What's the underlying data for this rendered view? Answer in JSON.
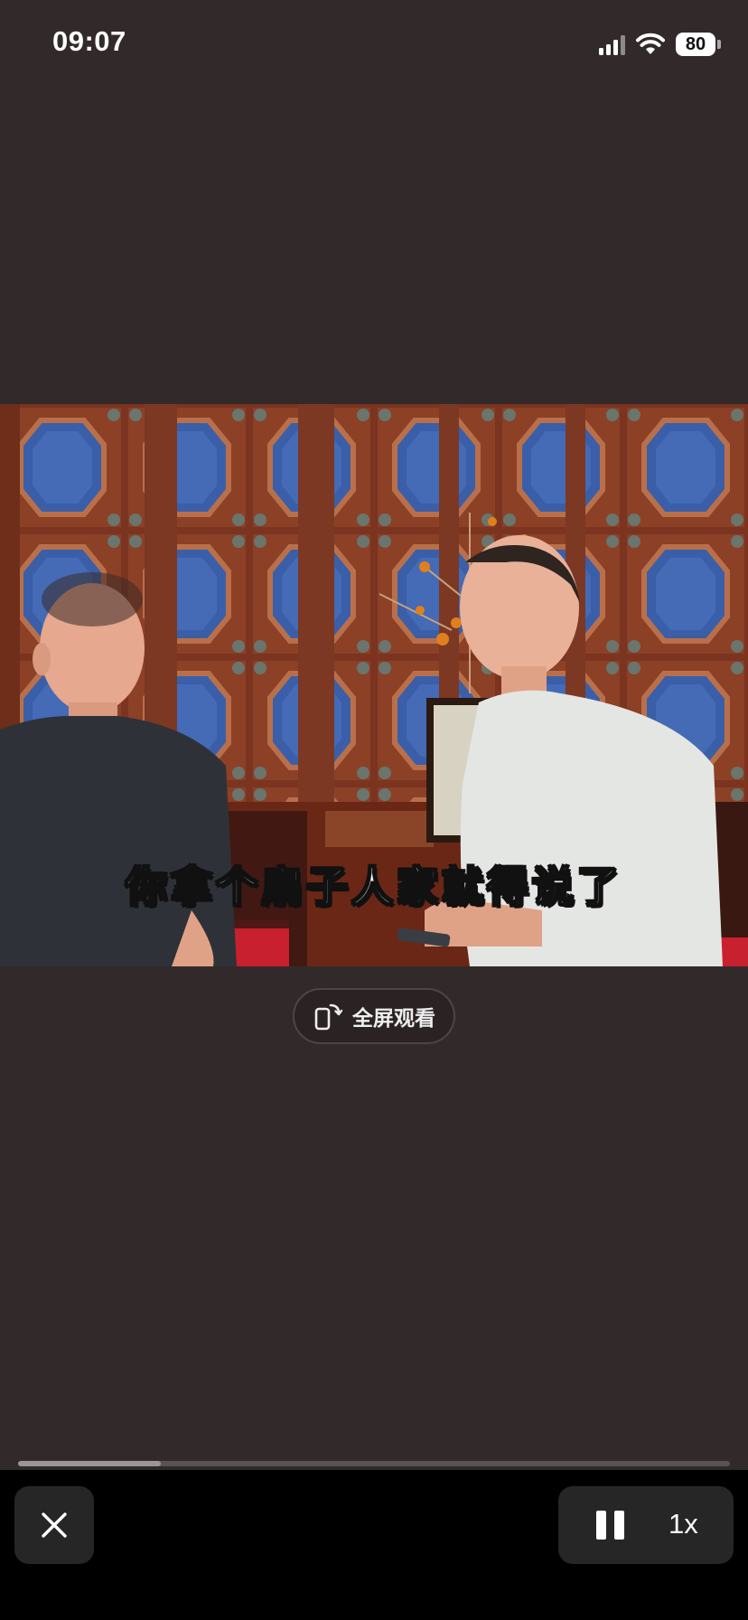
{
  "status_bar": {
    "time": "09:07",
    "battery": "80"
  },
  "video": {
    "subtitle": "你拿个扇子人家就得说了"
  },
  "fullscreen_button": {
    "label": "全屏观看"
  },
  "playback": {
    "progress": 0.2,
    "speed": "1x"
  },
  "icons": {
    "close": "close-icon",
    "pause": "pause-icon",
    "rotate": "rotate-screen-icon",
    "wifi": "wifi-icon",
    "signal": "signal-icon",
    "battery": "battery-icon"
  },
  "colors": {
    "background": "#322a2a",
    "bottom_bar": "#000000",
    "control_bg": "#262626"
  }
}
